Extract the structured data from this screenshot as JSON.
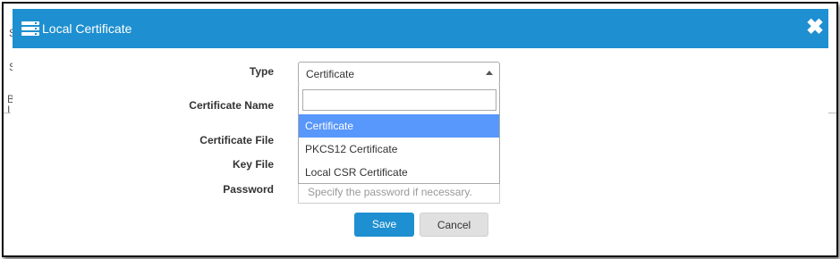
{
  "dialog": {
    "title": "Local Certificate",
    "title_icon": "server-icon",
    "close_icon": "close-icon",
    "close_glyph": "✖"
  },
  "form": {
    "type_label": "Type",
    "certificate_name_label": "Certificate Name",
    "certificate_file_label": "Certificate File",
    "key_file_label": "Key File",
    "password_label": "Password",
    "type_selected": "Certificate",
    "password_placeholder": "Specify the password if necessary."
  },
  "dropdown": {
    "search_value": "",
    "options": [
      "Certificate",
      "PKCS12 Certificate",
      "Local CSR Certificate"
    ],
    "selected_index": 0
  },
  "buttons": {
    "save": "Save",
    "cancel": "Cancel"
  },
  "background": {
    "fragments": [
      "S",
      "S",
      "B",
      "I"
    ]
  },
  "colors": {
    "titlebar": "#1e8fd0",
    "selected_option": "#5897fb",
    "save_button": "#1e8fd0"
  }
}
